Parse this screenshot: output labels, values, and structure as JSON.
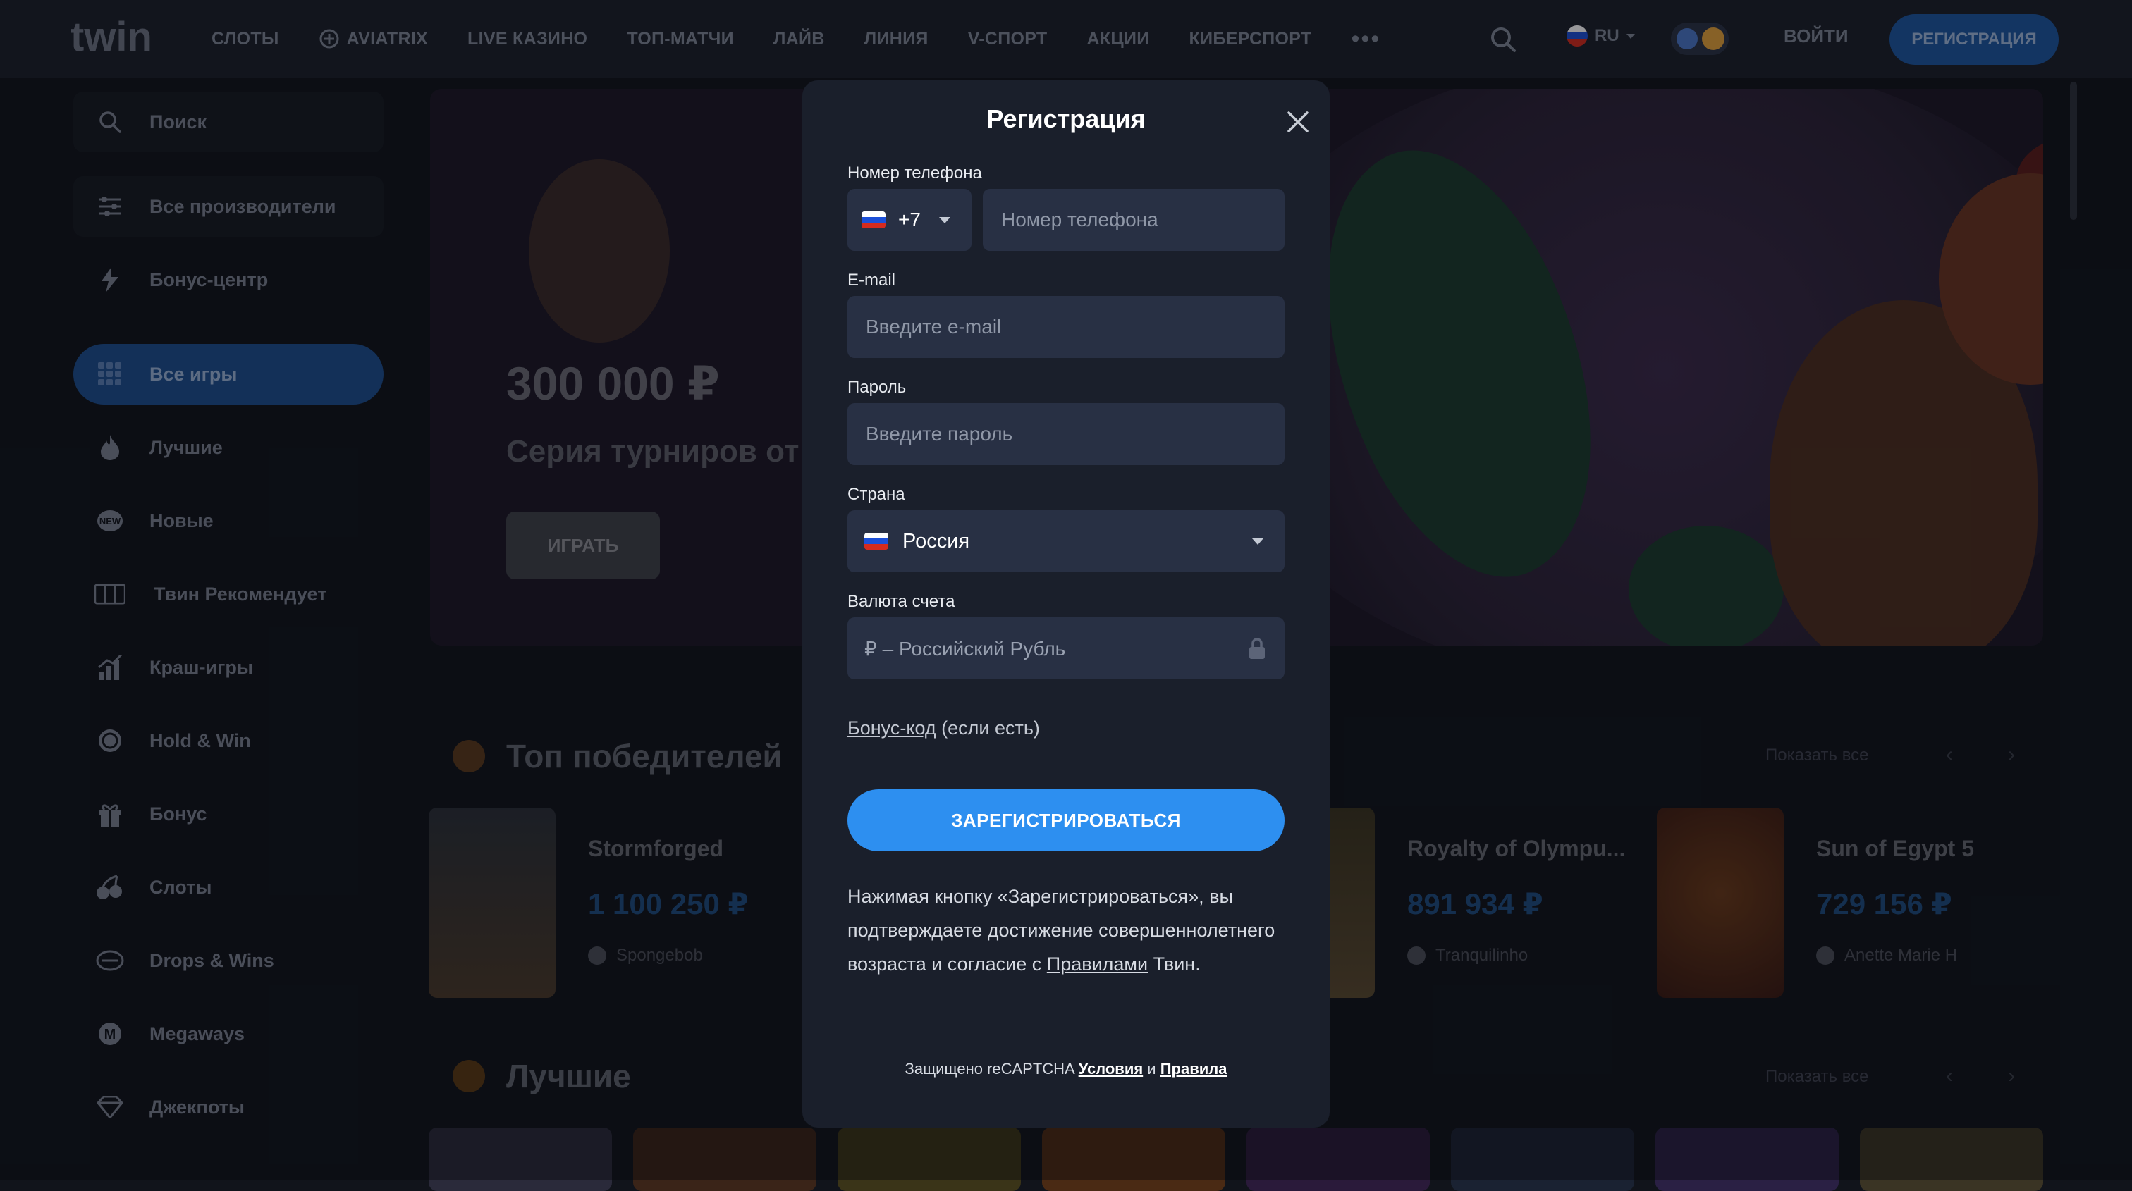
{
  "header": {
    "logo_text": "twin",
    "nav": [
      {
        "label": "СЛОТЫ"
      },
      {
        "label": "AVIATRIX"
      },
      {
        "label": "LIVE КАЗИНО"
      },
      {
        "label": "ТОП-МАТЧИ"
      },
      {
        "label": "ЛАЙВ"
      },
      {
        "label": "ЛИНИЯ"
      },
      {
        "label": "V-СПОРТ"
      },
      {
        "label": "АКЦИИ"
      },
      {
        "label": "КИБЕРСПОРТ"
      }
    ],
    "more": "•••",
    "language": "RU",
    "login_label": "ВОЙТИ",
    "register_label": "РЕГИСТРАЦИЯ"
  },
  "sidebar": {
    "items": [
      {
        "label": "Поиск",
        "icon": "search-icon"
      },
      {
        "label": "Все производители",
        "icon": "filter-icon"
      },
      {
        "label": "Бонус-центр",
        "icon": "lightning-icon"
      },
      {
        "label": "Все игры",
        "icon": "grid-icon",
        "active": true
      },
      {
        "label": "Лучшие",
        "icon": "fire-icon"
      },
      {
        "label": "Новые",
        "icon": "new-icon"
      },
      {
        "label": "Твин Рекомендует",
        "icon": "slot-machine-icon"
      },
      {
        "label": "Краш-игры",
        "icon": "chart-icon"
      },
      {
        "label": "Hold & Win",
        "icon": "coin-icon"
      },
      {
        "label": "Бонус",
        "icon": "gift-icon"
      },
      {
        "label": "Слоты",
        "icon": "cherries-icon"
      },
      {
        "label": "Drops & Wins",
        "icon": "drops-icon"
      },
      {
        "label": "Megaways",
        "icon": "megaways-icon"
      },
      {
        "label": "Джекпоты",
        "icon": "diamond-icon"
      }
    ]
  },
  "banner": {
    "amount": "300 000 ₽",
    "subtitle": "Серия турниров от",
    "play_label": "ИГРАТЬ"
  },
  "top_winners": {
    "title": "Топ победителей",
    "show_all": "Показать все",
    "items": [
      {
        "game": "Stormforged",
        "amount": "1 100 250 ₽",
        "user": "Spongebob"
      },
      {
        "game": "Royalty of Olympu...",
        "amount": "891 934 ₽",
        "user": "Tranquilinho"
      },
      {
        "game": "Sun of Egypt 5",
        "amount": "729 156 ₽",
        "user": "Anette Marie H"
      }
    ]
  },
  "best": {
    "title": "Лучшие",
    "show_all": "Показать все"
  },
  "modal": {
    "title": "Регистрация",
    "phone": {
      "label": "Номер телефона",
      "code": "+7",
      "placeholder": "Номер телефона"
    },
    "email": {
      "label": "E-mail",
      "placeholder": "Введите e-mail"
    },
    "password": {
      "label": "Пароль",
      "placeholder": "Введите пароль"
    },
    "country": {
      "label": "Страна",
      "value": "Россия"
    },
    "currency": {
      "label": "Валюта счета",
      "value": "₽ – Российский Рубль"
    },
    "bonus": {
      "link": "Бонус-код",
      "suffix": " (если есть)"
    },
    "submit_label": "ЗАРЕГИСТРИРОВАТЬСЯ",
    "terms": {
      "text": "Нажимая кнопку «Зарегистрироваться», вы подтверждаете достижение совершеннолетнего возраста и согласие с ",
      "link": "Правилами",
      "suffix": " Твин."
    },
    "recaptcha": {
      "prefix": "Защищено reCAPTCHA ",
      "terms_link": "Условия",
      "and": " и ",
      "rules_link": "Правила"
    }
  },
  "colors": {
    "accent": "#2d8ff0",
    "modal_bg": "#1a1f2b",
    "field_bg": "#283044",
    "page_bg": "#11141b"
  }
}
